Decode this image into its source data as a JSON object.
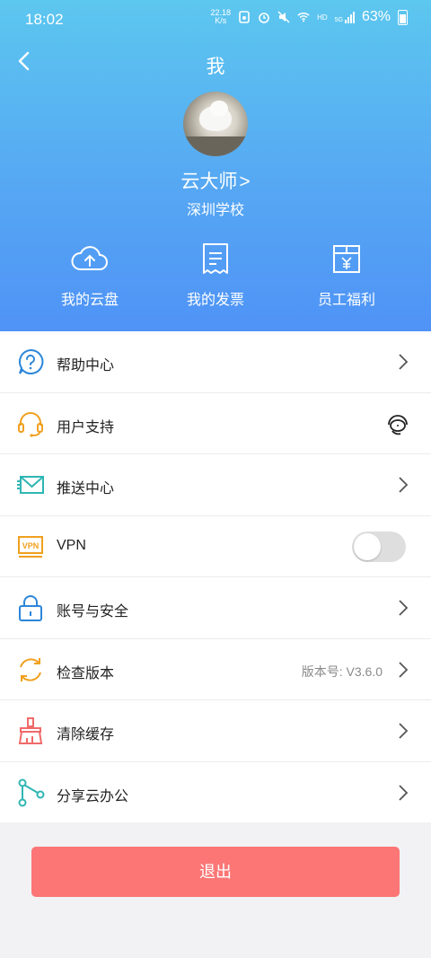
{
  "status_bar": {
    "time": "18:02",
    "net_speed_value": "22.18",
    "net_speed_unit": "K/s",
    "battery": "63%",
    "hd_label": "HD",
    "signal_label": "5G"
  },
  "header": {
    "title": "我",
    "username": "云大师",
    "username_chevron": ">",
    "school": "深圳学校"
  },
  "quick_actions": [
    {
      "label": "我的云盘",
      "icon": "cloud-upload-icon"
    },
    {
      "label": "我的发票",
      "icon": "receipt-icon"
    },
    {
      "label": "员工福利",
      "icon": "gift-box-icon"
    }
  ],
  "menu": {
    "help": {
      "label": "帮助中心",
      "icon": "question-bubble-icon"
    },
    "support": {
      "label": "用户支持",
      "icon": "headset-icon"
    },
    "push": {
      "label": "推送中心",
      "icon": "envelope-icon"
    },
    "vpn": {
      "label": "VPN",
      "icon": "vpn-badge-icon",
      "icon_text": "VPN",
      "enabled": false
    },
    "security": {
      "label": "账号与安全",
      "icon": "lock-icon"
    },
    "update": {
      "label": "检查版本",
      "icon": "refresh-icon",
      "version": "版本号: V3.6.0"
    },
    "cache": {
      "label": "清除缓存",
      "icon": "broom-icon"
    },
    "share": {
      "label": "分享云办公",
      "icon": "share-nodes-icon"
    }
  },
  "logout": {
    "label": "退出"
  },
  "colors": {
    "header_top": "#5cc7ef",
    "header_bottom": "#4f93f6",
    "logout_button": "#fc7676",
    "blue_icon": "#2b86d8",
    "orange_icon": "#f0a01e",
    "teal_icon": "#2fb6b3",
    "red_icon": "#f06a6a"
  }
}
